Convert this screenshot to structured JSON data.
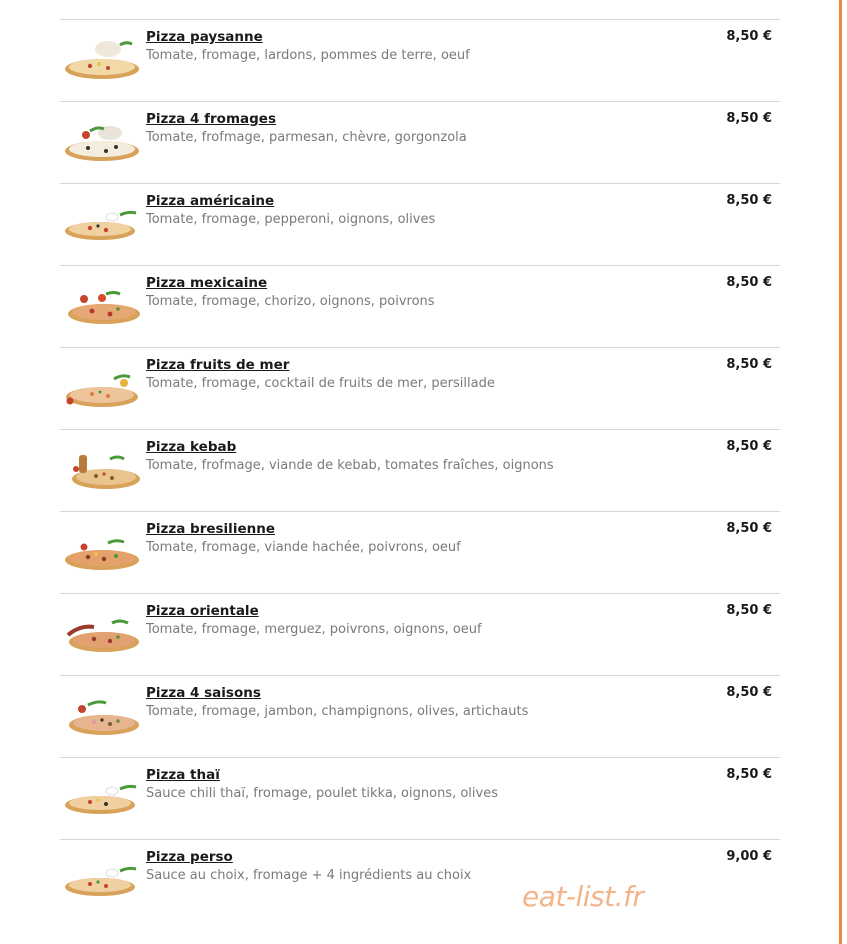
{
  "menu": {
    "items": [
      {
        "name": "Pizza paysanne",
        "description": "Tomate, fromage, lardons, pommes de terre, oeuf",
        "price": "8,50 €"
      },
      {
        "name": "Pizza 4 fromages",
        "description": "Tomate, frofmage, parmesan, chèvre, gorgonzola",
        "price": "8,50 €"
      },
      {
        "name": "Pizza américaine",
        "description": "Tomate, fromage, pepperoni, oignons, olives",
        "price": "8,50 €"
      },
      {
        "name": "Pizza mexicaine",
        "description": "Tomate, fromage, chorizo, oignons, poivrons",
        "price": "8,50 €"
      },
      {
        "name": "Pizza fruits de mer",
        "description": "Tomate, fromage, cocktail de fruits de mer, persillade",
        "price": "8,50 €"
      },
      {
        "name": "Pizza kebab",
        "description": "Tomate, frofmage, viande de kebab, tomates fraîches, oignons",
        "price": "8,50 €"
      },
      {
        "name": "Pizza bresilienne",
        "description": "Tomate, fromage, viande hachée, poivrons, oeuf",
        "price": "8,50 €"
      },
      {
        "name": "Pizza orientale",
        "description": "Tomate, fromage, merguez, poivrons, oignons, oeuf",
        "price": "8,50 €"
      },
      {
        "name": "Pizza 4 saisons",
        "description": "Tomate, fromage, jambon, champignons, olives, artichauts",
        "price": "8,50 €"
      },
      {
        "name": "Pizza thaï",
        "description": "Sauce chili thaï, fromage, poulet tikka, oignons, olives",
        "price": "8,50 €"
      },
      {
        "name": "Pizza perso",
        "description": "Sauce au choix, fromage + 4 ingrédients au choix",
        "price": "9,00 €"
      }
    ]
  },
  "watermark": "eat-list.fr",
  "colors": {
    "accent_border": "#e88a3a",
    "watermark": "#f3b48a",
    "divider": "#d8d8d8"
  }
}
